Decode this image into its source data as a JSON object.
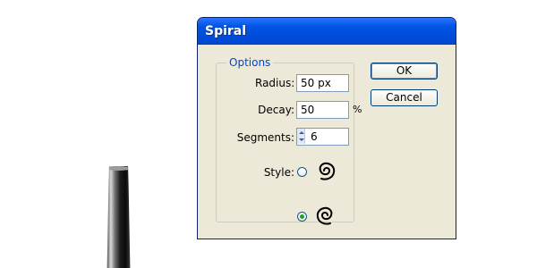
{
  "dialog": {
    "title": "Spiral",
    "options_label": "Options",
    "fields": {
      "radius": {
        "label": "Radius:",
        "value": "50 px"
      },
      "decay": {
        "label": "Decay:",
        "value": "50",
        "unit": "%"
      },
      "segments": {
        "label": "Segments:",
        "value": "6"
      }
    },
    "style": {
      "label": "Style:",
      "options": [
        "clockwise-spiral",
        "counterclockwise-spiral"
      ],
      "selected": "counterclockwise-spiral"
    },
    "buttons": {
      "ok": "OK",
      "cancel": "Cancel"
    }
  },
  "colors": {
    "title_bar": "#0054e3",
    "dialog_bg": "#ece9d8",
    "group_title": "#0046d5",
    "radio_selected": "#21a121"
  }
}
